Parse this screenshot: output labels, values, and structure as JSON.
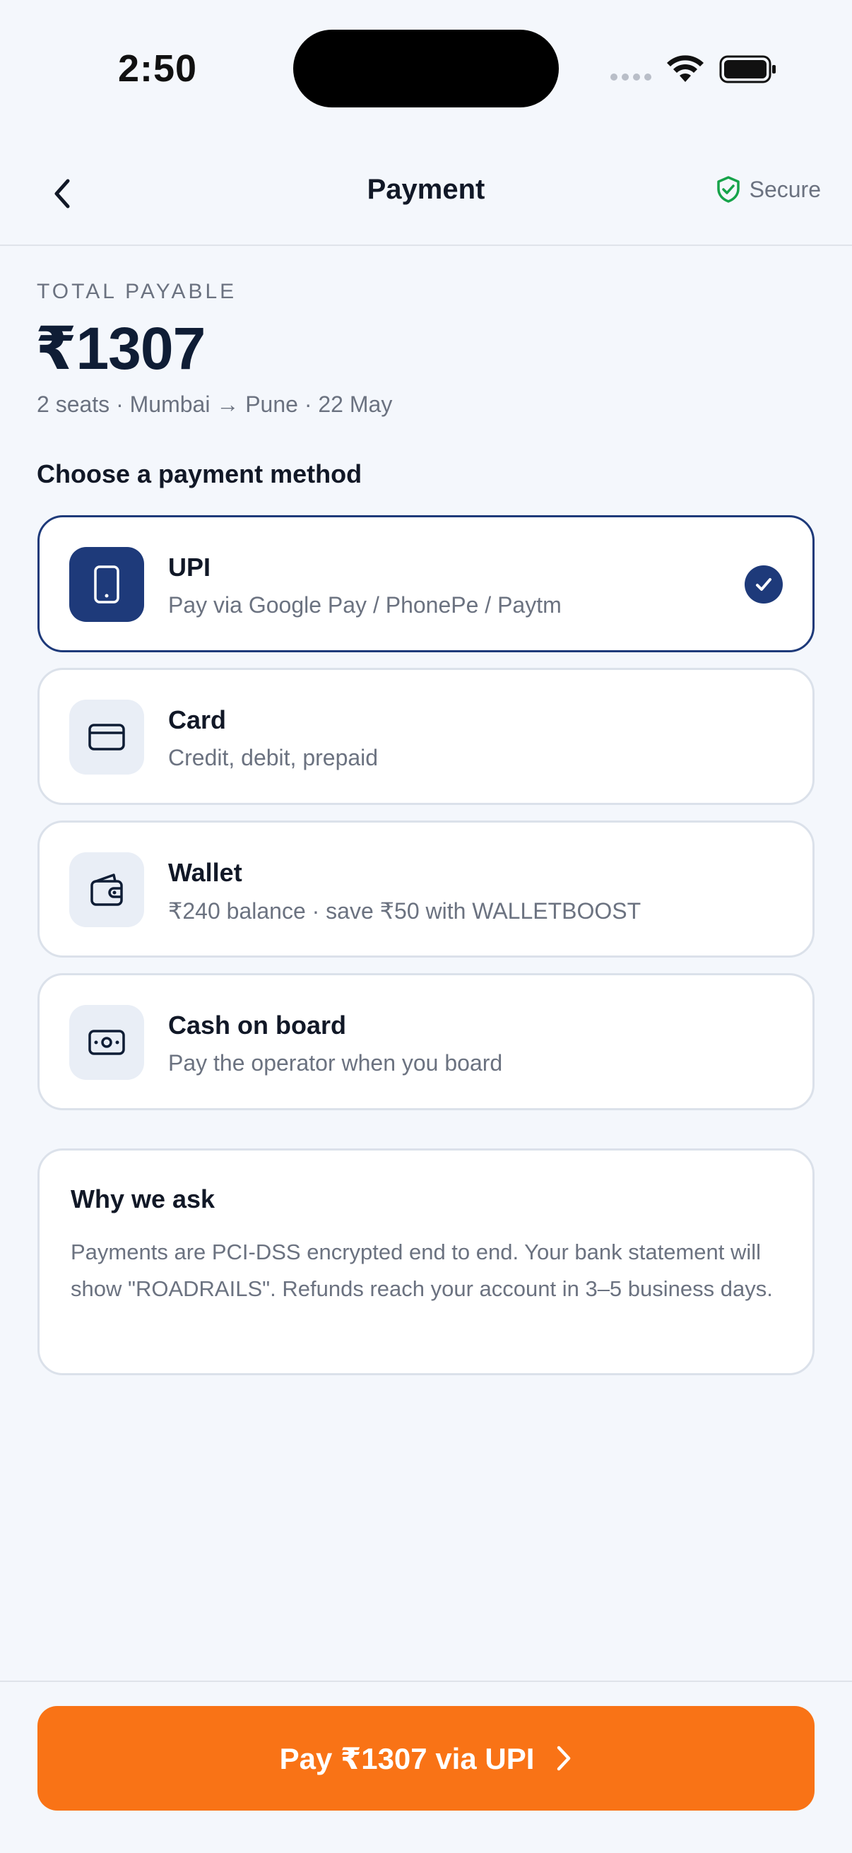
{
  "status_bar": {
    "time": "2:50"
  },
  "header": {
    "title": "Payment",
    "secure_label": "Secure"
  },
  "total": {
    "label": "TOTAL PAYABLE",
    "amount": "₹1307",
    "summary": "2 seats · Mumbai → Pune · 22 May"
  },
  "section_title": "Choose a payment method",
  "methods": [
    {
      "title": "UPI",
      "subtitle": "Pay via Google Pay / PhonePe / Paytm",
      "icon": "phone-icon",
      "selected": true
    },
    {
      "title": "Card",
      "subtitle": "Credit, debit, prepaid",
      "icon": "card-icon",
      "selected": false
    },
    {
      "title": "Wallet",
      "subtitle": "₹240 balance · save ₹50 with WALLETBOOST",
      "icon": "wallet-icon",
      "selected": false
    },
    {
      "title": "Cash on board",
      "subtitle": "Pay the operator when you board",
      "icon": "cash-icon",
      "selected": false
    }
  ],
  "info": {
    "title": "Why we ask",
    "body": "Payments are PCI-DSS encrypted end to end. Your bank statement will show \"ROADRAILS\". Refunds reach your account in 3–5 business days."
  },
  "pay_button": {
    "label": "Pay ₹1307 via UPI"
  },
  "colors": {
    "accent": "#1e3a7a",
    "cta": "#f97316",
    "secure": "#16a34a",
    "background": "#f4f7fc"
  }
}
